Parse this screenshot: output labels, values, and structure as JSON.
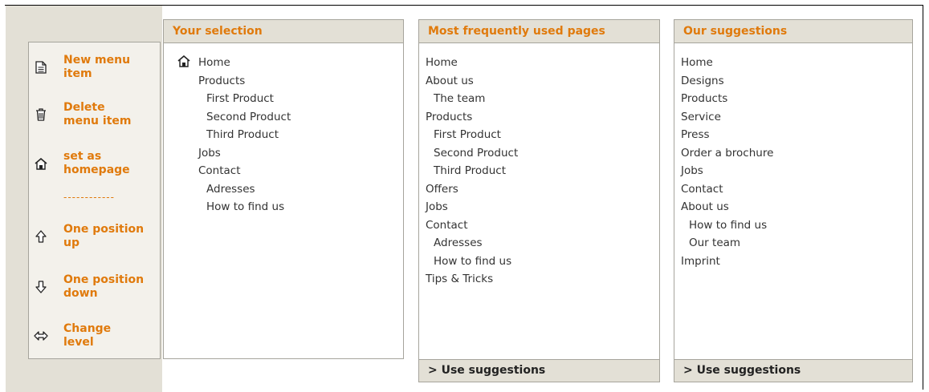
{
  "toolbar": {
    "items": [
      {
        "icon": "document-icon",
        "label": "New menu\nitem"
      },
      {
        "icon": "trash-icon",
        "label": "Delete\nmenu item"
      },
      {
        "icon": "home-icon",
        "label": "set as\nhomepage"
      },
      {
        "icon": "arrow-up-icon",
        "label": "One position\nup"
      },
      {
        "icon": "arrow-down-icon",
        "label": "One position\ndown"
      },
      {
        "icon": "change-level-icon",
        "label": "Change\nlevel"
      }
    ],
    "separator": "------------"
  },
  "your_selection": {
    "title": "Your selection",
    "items": [
      "Home",
      "Products",
      "First Product",
      "Second Product",
      "Third Product",
      "Jobs",
      "Contact",
      "Adresses",
      "How to find us"
    ]
  },
  "most_frequent": {
    "title": "Most frequently used pages",
    "items": [
      "Home",
      "About us",
      "The team",
      "Products",
      "First Product",
      "Second Product",
      "Third Product",
      "Offers",
      "Jobs",
      "Contact",
      "Adresses",
      "How to find us",
      "Tips & Tricks"
    ],
    "footer": "> Use suggestions"
  },
  "suggestions": {
    "title": "Our suggestions",
    "items": [
      "Home",
      "Designs",
      "Products",
      "Service",
      "Press",
      "Order a brochure",
      "Jobs",
      "Contact",
      "About us",
      "How to find us",
      "Our team",
      "Imprint"
    ],
    "footer": "> Use suggestions"
  },
  "colors": {
    "accent": "#e07a0c",
    "panel_bg": "#e3e0d6",
    "border": "#a6a49c"
  }
}
